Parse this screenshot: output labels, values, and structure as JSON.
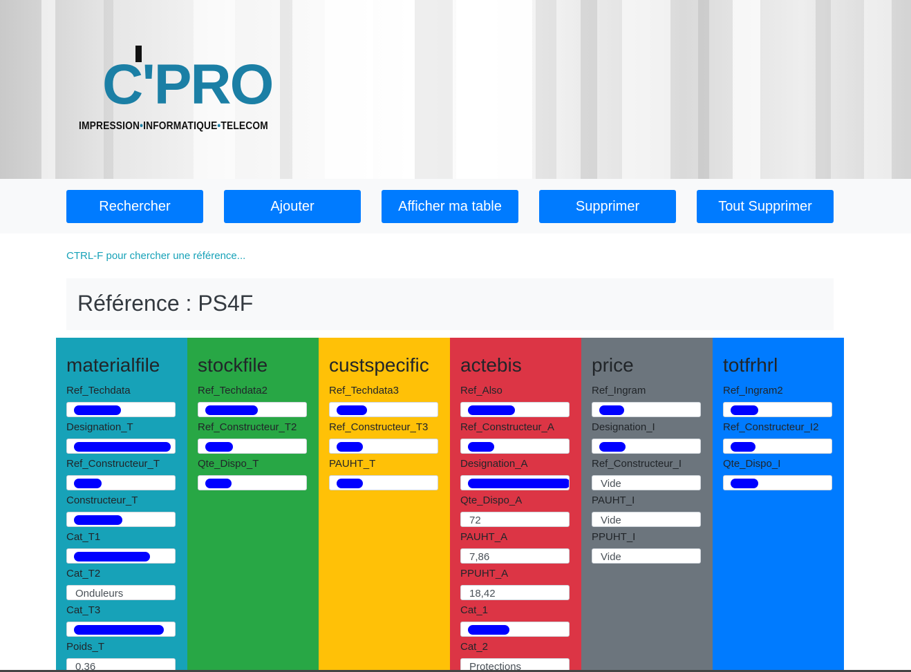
{
  "logo": {
    "main": "C'PRO",
    "sub_parts": [
      "IMPRESSION",
      "INFORMATIQUE",
      "TELECOM"
    ]
  },
  "nav": {
    "buttons": [
      "Rechercher",
      "Ajouter",
      "Afficher ma table",
      "Supprimer",
      "Tout Supprimer"
    ]
  },
  "hint": "CTRL-F pour chercher une référence...",
  "reference_title": "Référence : PS4F",
  "colors": {
    "materialfile": "#17a2b8",
    "stockfile": "#28a745",
    "custspecific": "#ffc107",
    "actebis": "#dc3545",
    "price": "#6c757d",
    "totfrhrl": "#007bff",
    "button": "#007bff",
    "redaction": "#0000ff"
  },
  "columns": [
    {
      "title": "materialfile",
      "fields": [
        {
          "label": "Ref_Techdata",
          "value": "",
          "redacted": true
        },
        {
          "label": "Designation_T",
          "value": "",
          "redacted": true
        },
        {
          "label": "Ref_Constructeur_T",
          "value": "",
          "redacted": true
        },
        {
          "label": "Constructeur_T",
          "value": "",
          "redacted": true
        },
        {
          "label": "Cat_T1",
          "value": "",
          "redacted": true
        },
        {
          "label": "Cat_T2",
          "value": "Onduleurs",
          "redacted": false
        },
        {
          "label": "Cat_T3",
          "value": "",
          "redacted": true
        },
        {
          "label": "Poids_T",
          "value": "0,36",
          "redacted": false
        }
      ]
    },
    {
      "title": "stockfile",
      "fields": [
        {
          "label": "Ref_Techdata2",
          "value": "",
          "redacted": true
        },
        {
          "label": "Ref_Constructeur_T2",
          "value": "",
          "redacted": true
        },
        {
          "label": "Qte_Dispo_T",
          "value": "",
          "redacted": true
        }
      ]
    },
    {
      "title": "custspecific",
      "fields": [
        {
          "label": "Ref_Techdata3",
          "value": "",
          "redacted": true
        },
        {
          "label": "Ref_Constructeur_T3",
          "value": "",
          "redacted": true
        },
        {
          "label": "PAUHT_T",
          "value": "",
          "redacted": true
        }
      ]
    },
    {
      "title": "actebis",
      "fields": [
        {
          "label": "Ref_Also",
          "value": "",
          "redacted": true
        },
        {
          "label": "Ref_Constructeur_A",
          "value": "",
          "redacted": true
        },
        {
          "label": "Designation_A",
          "value": "",
          "redacted": true
        },
        {
          "label": "Qte_Dispo_A",
          "value": "72",
          "redacted": false
        },
        {
          "label": "PAUHT_A",
          "value": "7,86",
          "redacted": false
        },
        {
          "label": "PPUHT_A",
          "value": "18,42",
          "redacted": false
        },
        {
          "label": "Cat_1",
          "value": "",
          "redacted": true
        },
        {
          "label": "Cat_2",
          "value": "Protections",
          "redacted": false
        }
      ]
    },
    {
      "title": "price",
      "fields": [
        {
          "label": "Ref_Ingram",
          "value": "",
          "redacted": true
        },
        {
          "label": "Designation_I",
          "value": "",
          "redacted": true
        },
        {
          "label": "Ref_Constructeur_I",
          "value": "Vide",
          "redacted": false
        },
        {
          "label": "PAUHT_I",
          "value": "Vide",
          "redacted": false
        },
        {
          "label": "PPUHT_I",
          "value": "Vide",
          "redacted": false
        }
      ]
    },
    {
      "title": "totfrhrl",
      "fields": [
        {
          "label": "Ref_Ingram2",
          "value": "",
          "redacted": true
        },
        {
          "label": "Ref_Constructeur_I2",
          "value": "",
          "redacted": true
        },
        {
          "label": "Qte_Dispo_I",
          "value": "",
          "redacted": true
        }
      ]
    }
  ]
}
